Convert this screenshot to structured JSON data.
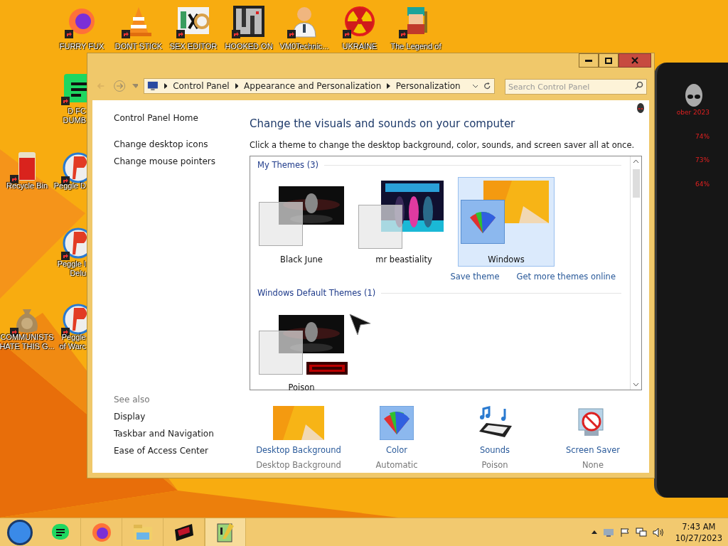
{
  "desktop_icons": [
    {
      "label": "FURRY FUX",
      "kind": "browser"
    },
    {
      "label": "DONT STICK",
      "kind": "cone"
    },
    {
      "label": "SEX EDITOR",
      "kind": "hex"
    },
    {
      "label": "HOOKED ON",
      "kind": "maze"
    },
    {
      "label": "VM0Technic...",
      "kind": "doctor"
    },
    {
      "label": "UKRAINE",
      "kind": "radiation"
    },
    {
      "label": "The Legend of",
      "kind": "hero"
    },
    {
      "label": "D FC\nDUMB",
      "kind": "notes"
    },
    {
      "label": "Recycle Bin",
      "kind": "bin"
    },
    {
      "label": "Peggle D",
      "kind": "peggle"
    },
    {
      "label": "Peggle I\nDelu",
      "kind": "peggle"
    },
    {
      "label": "COMMUNISTS\nHATE THIS G...",
      "kind": "money"
    },
    {
      "label": "Peggle\nof Warc",
      "kind": "peggle"
    }
  ],
  "window": {
    "address": [
      "Control Panel",
      "Appearance and Personalization",
      "Personalization"
    ],
    "search": {
      "placeholder": "Search Control Panel"
    },
    "sidebar": {
      "items": [
        "Control Panel Home",
        "Change desktop icons",
        "Change mouse pointers"
      ],
      "see_also_title": "See also",
      "see_also": [
        "Display",
        "Taskbar and Navigation",
        "Ease of Access Center"
      ]
    },
    "heading": "Change the visuals and sounds on your computer",
    "subtitle": "Click a theme to change the desktop background, color, sounds, and screen saver all at once.",
    "theme_groups": [
      {
        "title": "My Themes (3)",
        "themes": [
          {
            "name": "Black June",
            "kind": "dark",
            "selected": false
          },
          {
            "name": "mr beastiality",
            "kind": "poster",
            "selected": false
          },
          {
            "name": "Windows",
            "kind": "windows",
            "selected": true
          }
        ],
        "links": [
          "Save theme",
          "Get more themes online"
        ]
      },
      {
        "title": "Windows Default Themes (1)",
        "themes": [
          {
            "name": "Poison",
            "kind": "dark_badge",
            "selected": false
          }
        ]
      }
    ],
    "settings": [
      {
        "label": "Desktop Background",
        "value": "Desktop Background",
        "kind": "background"
      },
      {
        "label": "Color",
        "value": "Automatic",
        "kind": "color"
      },
      {
        "label": "Sounds",
        "value": "Poison",
        "kind": "sounds"
      },
      {
        "label": "Screen Saver",
        "value": "None",
        "kind": "screensaver"
      }
    ]
  },
  "gadget": {
    "texts": [
      "ober 2023",
      "74%",
      "73%",
      "64%"
    ]
  },
  "taskbar": {
    "apps": [
      {
        "kind": "chat",
        "active": false
      },
      {
        "kind": "firefox",
        "active": false
      },
      {
        "kind": "explorer",
        "active": false
      },
      {
        "kind": "tape",
        "active": false
      },
      {
        "kind": "notepad",
        "active": true
      }
    ],
    "time": "7:43 AM",
    "date": "10/27/2023"
  }
}
